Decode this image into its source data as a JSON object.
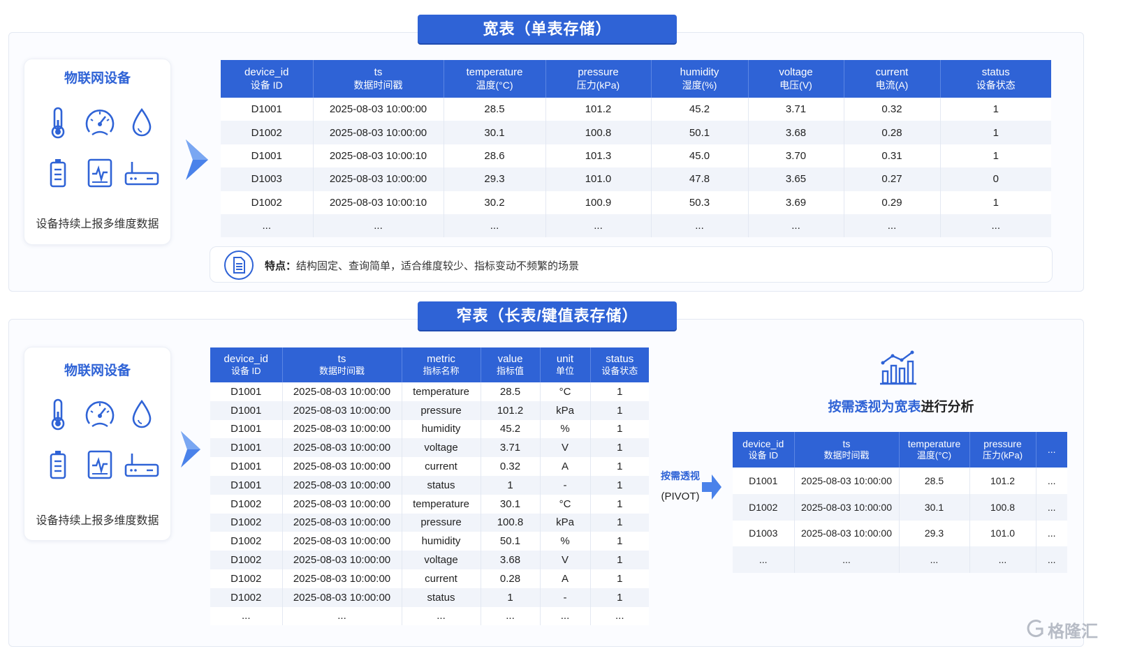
{
  "wide": {
    "banner": "宽表（单表存储）",
    "device": {
      "title": "物联网设备",
      "caption": "设备持续上报多维度数据"
    },
    "columns": [
      {
        "en": "device_id",
        "cn": "设备 ID"
      },
      {
        "en": "ts",
        "cn": "数据时间戳"
      },
      {
        "en": "temperature",
        "cn": "温度(°C)"
      },
      {
        "en": "pressure",
        "cn": "压力(kPa)"
      },
      {
        "en": "humidity",
        "cn": "湿度(%)"
      },
      {
        "en": "voltage",
        "cn": "电压(V)"
      },
      {
        "en": "current",
        "cn": "电流(A)"
      },
      {
        "en": "status",
        "cn": "设备状态"
      }
    ],
    "rows": [
      [
        "D1001",
        "2025-08-03 10:00:00",
        "28.5",
        "101.2",
        "45.2",
        "3.71",
        "0.32",
        "1"
      ],
      [
        "D1002",
        "2025-08-03 10:00:00",
        "30.1",
        "100.8",
        "50.1",
        "3.68",
        "0.28",
        "1"
      ],
      [
        "D1001",
        "2025-08-03 10:00:10",
        "28.6",
        "101.3",
        "45.0",
        "3.70",
        "0.31",
        "1"
      ],
      [
        "D1003",
        "2025-08-03 10:00:00",
        "29.3",
        "101.0",
        "47.8",
        "3.65",
        "0.27",
        "0"
      ],
      [
        "D1002",
        "2025-08-03 10:00:10",
        "30.2",
        "100.9",
        "50.3",
        "3.69",
        "0.29",
        "1"
      ],
      [
        "...",
        "...",
        "...",
        "...",
        "...",
        "...",
        "...",
        "..."
      ]
    ],
    "feature_label": "特点：",
    "feature_text": "结构固定、查询简单，适合维度较少、指标变动不频繁的场景"
  },
  "narrow": {
    "banner": "窄表（长表/键值表存储）",
    "device": {
      "title": "物联网设备",
      "caption": "设备持续上报多维度数据"
    },
    "columns": [
      {
        "en": "device_id",
        "cn": "设备 ID"
      },
      {
        "en": "ts",
        "cn": "数据时间戳"
      },
      {
        "en": "metric",
        "cn": "指标名称"
      },
      {
        "en": "value",
        "cn": "指标值"
      },
      {
        "en": "unit",
        "cn": "单位"
      },
      {
        "en": "status",
        "cn": "设备状态"
      }
    ],
    "rows": [
      [
        "D1001",
        "2025-08-03 10:00:00",
        "temperature",
        "28.5",
        "°C",
        "1"
      ],
      [
        "D1001",
        "2025-08-03 10:00:00",
        "pressure",
        "101.2",
        "kPa",
        "1"
      ],
      [
        "D1001",
        "2025-08-03 10:00:00",
        "humidity",
        "45.2",
        "%",
        "1"
      ],
      [
        "D1001",
        "2025-08-03 10:00:00",
        "voltage",
        "3.71",
        "V",
        "1"
      ],
      [
        "D1001",
        "2025-08-03 10:00:00",
        "current",
        "0.32",
        "A",
        "1"
      ],
      [
        "D1001",
        "2025-08-03 10:00:00",
        "status",
        "1",
        "-",
        "1"
      ],
      [
        "D1002",
        "2025-08-03 10:00:00",
        "temperature",
        "30.1",
        "°C",
        "1"
      ],
      [
        "D1002",
        "2025-08-03 10:00:00",
        "pressure",
        "100.8",
        "kPa",
        "1"
      ],
      [
        "D1002",
        "2025-08-03 10:00:00",
        "humidity",
        "50.1",
        "%",
        "1"
      ],
      [
        "D1002",
        "2025-08-03 10:00:00",
        "voltage",
        "3.68",
        "V",
        "1"
      ],
      [
        "D1002",
        "2025-08-03 10:00:00",
        "current",
        "0.28",
        "A",
        "1"
      ],
      [
        "D1002",
        "2025-08-03 10:00:00",
        "status",
        "1",
        "-",
        "1"
      ],
      [
        "...",
        "...",
        "...",
        "...",
        "...",
        "..."
      ]
    ],
    "pivot_line1": "按需透视",
    "pivot_line2": "(PIVOT)",
    "analysis_blue": "按需透视为宽表",
    "analysis_dark": "进行分析",
    "pivot_columns": [
      {
        "en": "device_id",
        "cn": "设备 ID"
      },
      {
        "en": "ts",
        "cn": "数据时间戳"
      },
      {
        "en": "temperature",
        "cn": "温度(°C)"
      },
      {
        "en": "pressure",
        "cn": "压力(kPa)"
      },
      {
        "en": "...",
        "cn": ""
      }
    ],
    "pivot_rows": [
      [
        "D1001",
        "2025-08-03 10:00:00",
        "28.5",
        "101.2",
        "..."
      ],
      [
        "D1002",
        "2025-08-03 10:00:00",
        "30.1",
        "100.8",
        "..."
      ],
      [
        "D1003",
        "2025-08-03 10:00:00",
        "29.3",
        "101.0",
        "..."
      ],
      [
        "...",
        "...",
        "...",
        "...",
        "..."
      ]
    ]
  },
  "watermark": "格隆汇",
  "colors": {
    "accent": "#2f63d6",
    "row_alt": "#f1f4fa",
    "panel_border": "#e3e8f2"
  }
}
